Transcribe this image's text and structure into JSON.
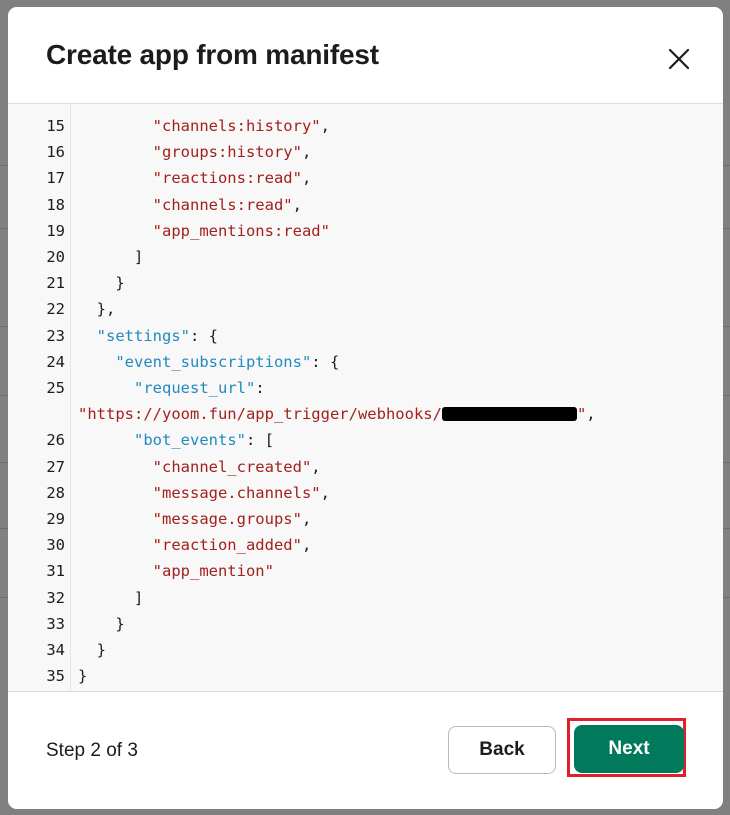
{
  "dialog": {
    "title": "Create app from manifest",
    "close_icon": "close-icon"
  },
  "code_lines": [
    {
      "n": "15",
      "parts": [
        {
          "t": "        ",
          "c": "punc"
        },
        {
          "t": "\"channels:history\"",
          "c": "str"
        },
        {
          "t": ",",
          "c": "punc"
        }
      ]
    },
    {
      "n": "16",
      "parts": [
        {
          "t": "        ",
          "c": "punc"
        },
        {
          "t": "\"groups:history\"",
          "c": "str"
        },
        {
          "t": ",",
          "c": "punc"
        }
      ]
    },
    {
      "n": "17",
      "parts": [
        {
          "t": "        ",
          "c": "punc"
        },
        {
          "t": "\"reactions:read\"",
          "c": "str"
        },
        {
          "t": ",",
          "c": "punc"
        }
      ]
    },
    {
      "n": "18",
      "parts": [
        {
          "t": "        ",
          "c": "punc"
        },
        {
          "t": "\"channels:read\"",
          "c": "str"
        },
        {
          "t": ",",
          "c": "punc"
        }
      ]
    },
    {
      "n": "19",
      "parts": [
        {
          "t": "        ",
          "c": "punc"
        },
        {
          "t": "\"app_mentions:read\"",
          "c": "str"
        }
      ]
    },
    {
      "n": "20",
      "parts": [
        {
          "t": "      ]",
          "c": "punc"
        }
      ]
    },
    {
      "n": "21",
      "parts": [
        {
          "t": "    }",
          "c": "punc"
        }
      ]
    },
    {
      "n": "22",
      "parts": [
        {
          "t": "  },",
          "c": "punc"
        }
      ]
    },
    {
      "n": "23",
      "parts": [
        {
          "t": "  ",
          "c": "punc"
        },
        {
          "t": "\"settings\"",
          "c": "key"
        },
        {
          "t": ": {",
          "c": "punc"
        }
      ]
    },
    {
      "n": "24",
      "parts": [
        {
          "t": "    ",
          "c": "punc"
        },
        {
          "t": "\"event_subscriptions\"",
          "c": "key"
        },
        {
          "t": ": {",
          "c": "punc"
        }
      ]
    },
    {
      "n": "25",
      "parts": [
        {
          "t": "      ",
          "c": "punc"
        },
        {
          "t": "\"request_url\"",
          "c": "key"
        },
        {
          "t": ":",
          "c": "punc"
        }
      ]
    },
    {
      "n": "",
      "parts": [
        {
          "t": "\"https://yoom.fun/app_trigger/webhooks/",
          "c": "str"
        },
        {
          "t": "",
          "c": "redact"
        },
        {
          "t": "\"",
          "c": "str"
        },
        {
          "t": ",",
          "c": "punc"
        }
      ]
    },
    {
      "n": "26",
      "parts": [
        {
          "t": "      ",
          "c": "punc"
        },
        {
          "t": "\"bot_events\"",
          "c": "key"
        },
        {
          "t": ": [",
          "c": "punc"
        }
      ]
    },
    {
      "n": "27",
      "parts": [
        {
          "t": "        ",
          "c": "punc"
        },
        {
          "t": "\"channel_created\"",
          "c": "str"
        },
        {
          "t": ",",
          "c": "punc"
        }
      ]
    },
    {
      "n": "28",
      "parts": [
        {
          "t": "        ",
          "c": "punc"
        },
        {
          "t": "\"message.channels\"",
          "c": "str"
        },
        {
          "t": ",",
          "c": "punc"
        }
      ]
    },
    {
      "n": "29",
      "parts": [
        {
          "t": "        ",
          "c": "punc"
        },
        {
          "t": "\"message.groups\"",
          "c": "str"
        },
        {
          "t": ",",
          "c": "punc"
        }
      ]
    },
    {
      "n": "30",
      "parts": [
        {
          "t": "        ",
          "c": "punc"
        },
        {
          "t": "\"reaction_added\"",
          "c": "str"
        },
        {
          "t": ",",
          "c": "punc"
        }
      ]
    },
    {
      "n": "31",
      "parts": [
        {
          "t": "        ",
          "c": "punc"
        },
        {
          "t": "\"app_mention\"",
          "c": "str"
        }
      ]
    },
    {
      "n": "32",
      "parts": [
        {
          "t": "      ]",
          "c": "punc"
        }
      ]
    },
    {
      "n": "33",
      "parts": [
        {
          "t": "    }",
          "c": "punc"
        }
      ]
    },
    {
      "n": "34",
      "parts": [
        {
          "t": "  }",
          "c": "punc"
        }
      ]
    },
    {
      "n": "35",
      "parts": [
        {
          "t": "}",
          "c": "punc"
        }
      ]
    }
  ],
  "footer": {
    "step": "Step 2 of 3",
    "back_label": "Back",
    "next_label": "Next"
  },
  "colors": {
    "string": "#a2211d",
    "key": "#1f8bbf",
    "primary_button": "#007a5a",
    "highlight": "#e0202b"
  }
}
